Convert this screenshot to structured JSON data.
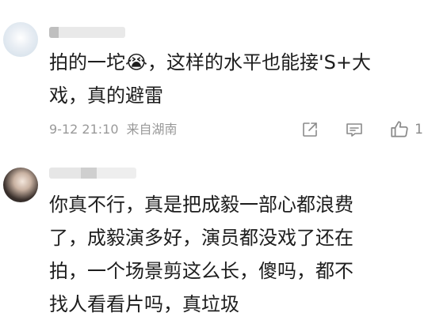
{
  "comments": [
    {
      "username": "",
      "text_line1": "拍的一坨😭，这样的水平也能接'S+大",
      "text_line2": "戏，真的避雷",
      "date": "9-12 21:10",
      "location": "来自湖南",
      "like_count": "1",
      "icons": [
        "share-icon",
        "comment-icon",
        "like-icon"
      ]
    },
    {
      "username": "",
      "text_line1": "你真不行，真是把成毅一部心都浪费",
      "text_line2": "了，成毅演多好，演员都没戏了还在",
      "text_line3": "拍，一个场景剪这么长，傻吗，都不",
      "text_line4": "找人看看片吗，真垃圾"
    }
  ]
}
